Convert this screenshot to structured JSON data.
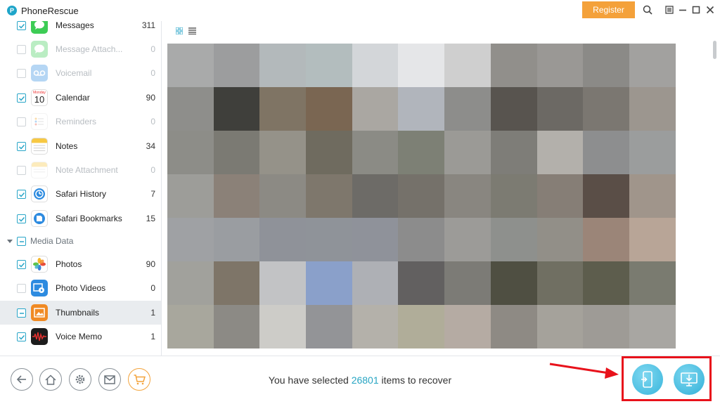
{
  "app": {
    "title": "PhoneRescue",
    "register_label": "Register"
  },
  "sidebar": {
    "items": [
      {
        "label": "Messages",
        "count": "311",
        "checked": true,
        "enabled": true
      },
      {
        "label": "Message Attach...",
        "count": "0",
        "checked": false,
        "enabled": false
      },
      {
        "label": "Voicemail",
        "count": "0",
        "checked": false,
        "enabled": false
      },
      {
        "label": "Calendar",
        "count": "90",
        "checked": true,
        "enabled": true,
        "icon_text": "10",
        "icon_day": "Monday"
      },
      {
        "label": "Reminders",
        "count": "0",
        "checked": false,
        "enabled": false
      },
      {
        "label": "Notes",
        "count": "34",
        "checked": true,
        "enabled": true
      },
      {
        "label": "Note Attachment",
        "count": "0",
        "checked": false,
        "enabled": false
      },
      {
        "label": "Safari History",
        "count": "7",
        "checked": true,
        "enabled": true
      },
      {
        "label": "Safari Bookmarks",
        "count": "15",
        "checked": true,
        "enabled": true
      }
    ],
    "category": {
      "label": "Media Data",
      "state": "partial"
    },
    "media_items": [
      {
        "label": "Photos",
        "count": "90",
        "checked": true
      },
      {
        "label": "Photo Videos",
        "count": "0",
        "checked": false
      },
      {
        "label": "Thumbnails",
        "count": "1",
        "checked": "partial",
        "selected": true
      },
      {
        "label": "Voice Memo",
        "count": "1",
        "checked": true
      }
    ]
  },
  "status": {
    "prefix": "You have selected ",
    "count": "26801",
    "suffix": " items to recover"
  },
  "colors": {
    "accent": "#27a5c3",
    "register": "#f4a13a",
    "highlight": "#e8121b",
    "thumbnails": [
      "#a9aaaa",
      "#9c9d9e",
      "#b3b9bb",
      "#b3bdbe",
      "#d3d6d9",
      "#e5e6e8",
      "#cfcfcf",
      "#918f8b",
      "#9a9895",
      "#8b8a87",
      "#a2a19f",
      "#8e8e8b",
      "#3f3f3b",
      "#7f7464",
      "#7a6652",
      "#aaa7a2",
      "#b1b5bc",
      "#8d8d8b",
      "#58544f",
      "#6c6964",
      "#7b7771",
      "#9c968f",
      "#8d8d88",
      "#7b7a73",
      "#959289",
      "#6f6b5f",
      "#8b8b85",
      "#7d8075",
      "#9b9a96",
      "#7e7d78",
      "#b3b0ab",
      "#8d8e8f",
      "#9b9d9d",
      "#9d9d99",
      "#8b8178",
      "#8c8a84",
      "#7e776c",
      "#6d6b67",
      "#75716a",
      "#898680",
      "#7c7b72",
      "#867e76",
      "#5a4e47",
      "#a0958b",
      "#9fa1a4",
      "#9a9da1",
      "#8f9299",
      "#8f9399",
      "#8f929a",
      "#8c8c8c",
      "#9c9b98",
      "#8e908d",
      "#928f88",
      "#9b8578",
      "#b8a597",
      "#a1a19c",
      "#7e7568",
      "#c2c3c5",
      "#8aa0ca",
      "#aeb0b5",
      "#626060",
      "#7c7b76",
      "#4f4f42",
      "#706f62",
      "#5d5d4d",
      "#7a7b70",
      "#a8a79d",
      "#8c8a85",
      "#cdccc8",
      "#939497",
      "#b4b1aa",
      "#b0ad99",
      "#b5aba3",
      "#8e8a84",
      "#a5a29b",
      "#9e9b96",
      "#a8a6a2"
    ]
  }
}
